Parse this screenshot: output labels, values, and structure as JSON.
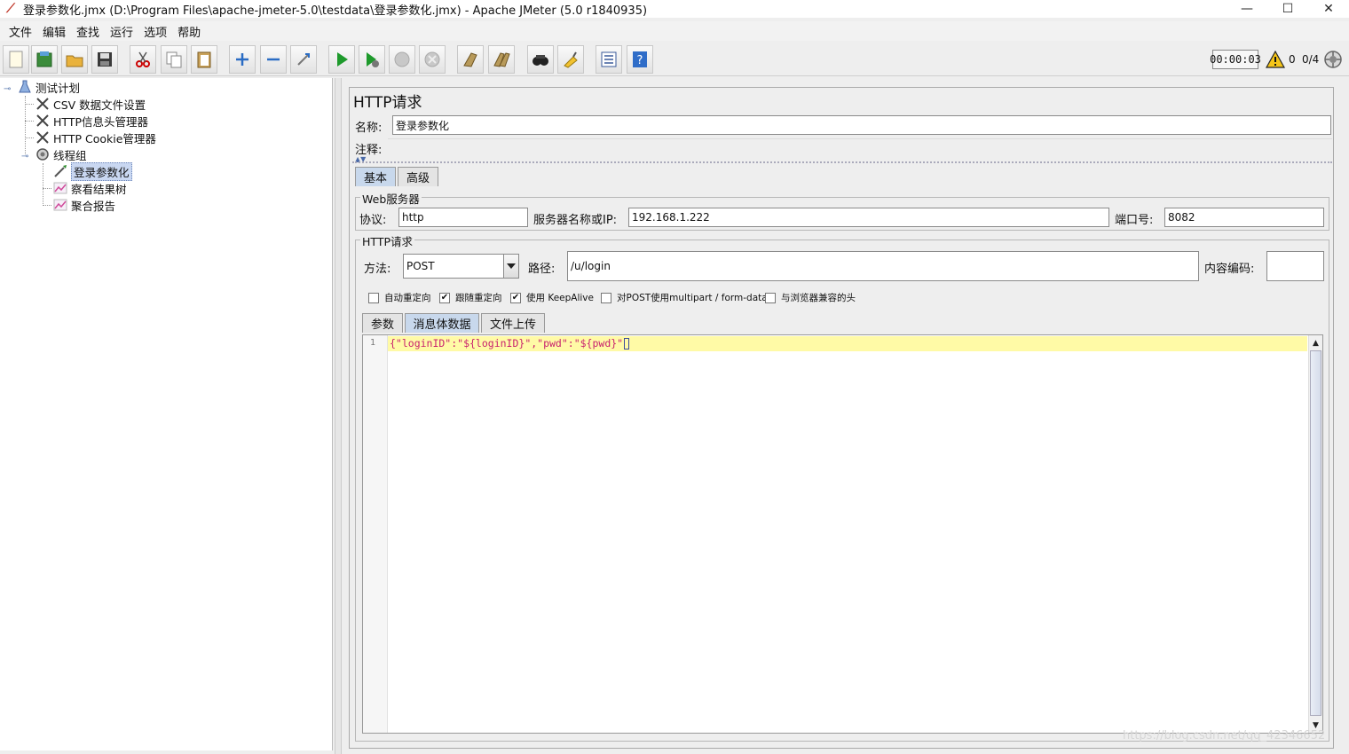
{
  "window": {
    "title": "登录参数化.jmx (D:\\Program Files\\apache-jmeter-5.0\\testdata\\登录参数化.jmx) - Apache JMeter (5.0 r1840935)",
    "minimize": "—",
    "maximize": "☐",
    "close": "✕"
  },
  "menu": [
    "文件",
    "编辑",
    "查找",
    "运行",
    "选项",
    "帮助"
  ],
  "toolbar": {
    "icons": [
      "new-icon",
      "templates-icon",
      "open-icon",
      "save-icon",
      "cut-icon",
      "copy-icon",
      "paste-icon",
      "expand-icon",
      "collapse-icon",
      "toggle-icon",
      "start-icon",
      "start-no-pause-icon",
      "stop-icon",
      "shutdown-icon",
      "clear-icon",
      "clear-all-icon",
      "search-icon",
      "reset-search-icon",
      "function-helper-icon",
      "help-icon"
    ],
    "timer": "00:00:03",
    "error_count": "0",
    "threads": "0/4"
  },
  "tree": [
    {
      "label": "测试计划",
      "icon": "test-plan-icon",
      "level": 0
    },
    {
      "label": "CSV 数据文件设置",
      "icon": "config-element-icon",
      "level": 1
    },
    {
      "label": "HTTP信息头管理器",
      "icon": "config-element-icon",
      "level": 1
    },
    {
      "label": "HTTP Cookie管理器",
      "icon": "config-element-icon",
      "level": 1
    },
    {
      "label": "线程组",
      "icon": "thread-group-icon",
      "level": 1
    },
    {
      "label": "登录参数化",
      "icon": "sampler-icon",
      "level": 2,
      "selected": true
    },
    {
      "label": "察看结果树",
      "icon": "listener-icon",
      "level": 2
    },
    {
      "label": "聚合报告",
      "icon": "listener-icon",
      "level": 2
    }
  ],
  "panel": {
    "title": "HTTP请求",
    "name_label": "名称:",
    "name_value": "登录参数化",
    "comment_label": "注释:",
    "tabs": [
      "基本",
      "高级"
    ],
    "web_server": {
      "group_title": "Web服务器",
      "protocol_label": "协议:",
      "protocol_value": "http",
      "server_label": "服务器名称或IP:",
      "server_value": "192.168.1.222",
      "port_label": "端口号:",
      "port_value": "8082"
    },
    "http_request": {
      "group_title": "HTTP请求",
      "method_label": "方法:",
      "method_value": "POST",
      "path_label": "路径:",
      "path_value": "/u/login",
      "encoding_label": "内容编码:",
      "encoding_value": ""
    },
    "checkboxes": [
      {
        "label": "自动重定向",
        "checked": false
      },
      {
        "label": "跟随重定向",
        "checked": true
      },
      {
        "label": "使用 KeepAlive",
        "checked": true
      },
      {
        "label": "对POST使用multipart / form-data",
        "checked": false
      },
      {
        "label": "与浏览器兼容的头",
        "checked": false
      }
    ],
    "body_tabs": [
      "参数",
      "消息体数据",
      "文件上传"
    ],
    "body_line_number": "1",
    "body_text": "{\"loginID\":\"${loginID}\",\"pwd\":\"${pwd}\""
  },
  "watermark": "https://blog.csdn.net/qq_42346652"
}
